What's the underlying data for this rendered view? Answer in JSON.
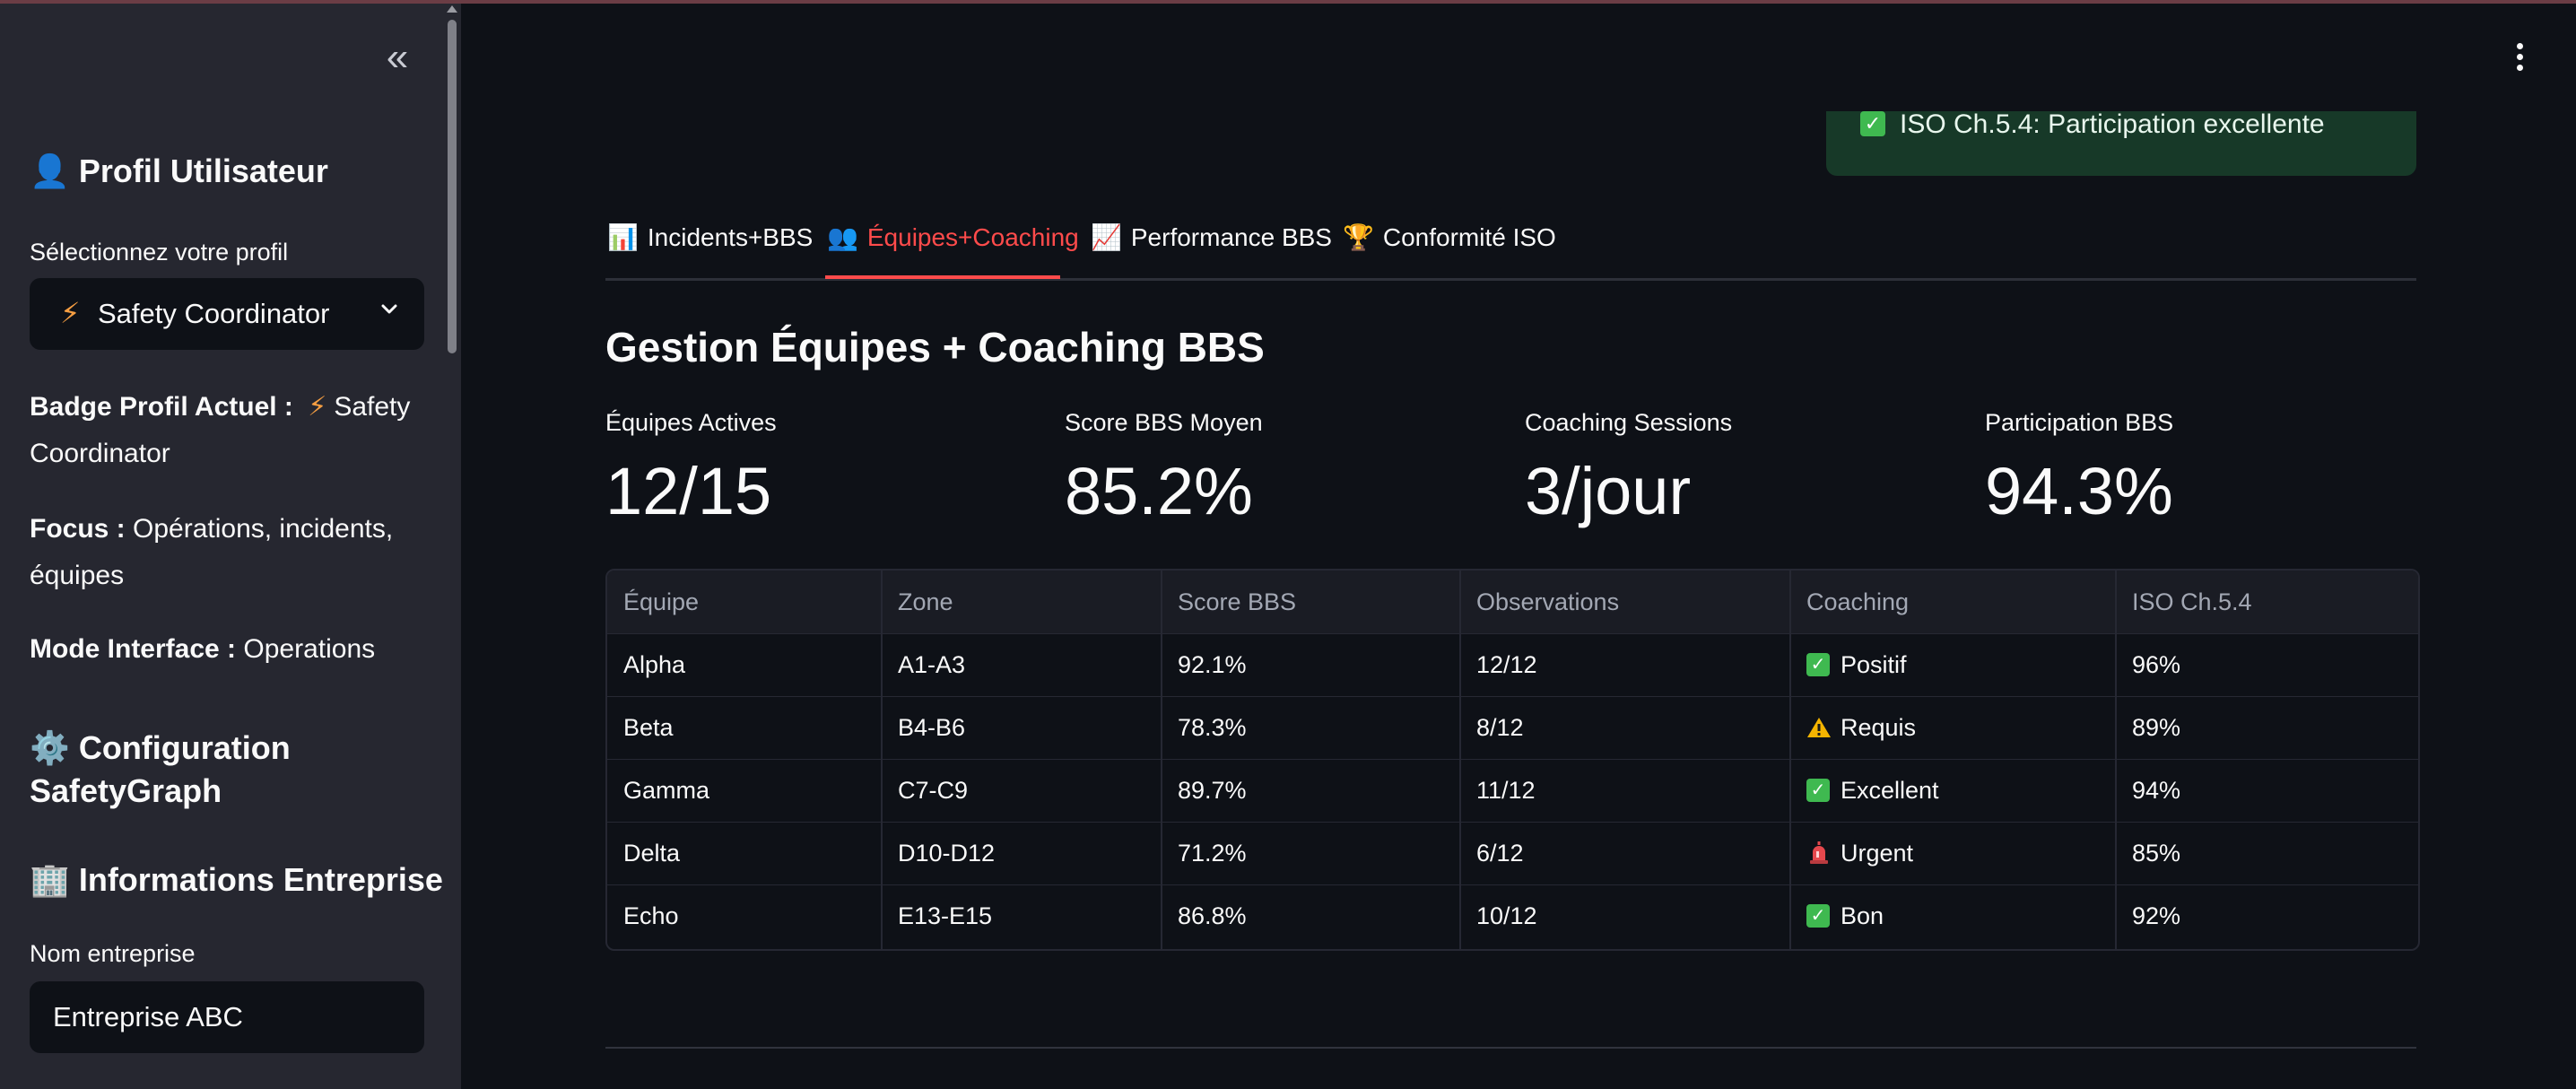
{
  "sidebar": {
    "collapse_icon": "«",
    "profile_heading": "Profil Utilisateur",
    "profile_icon": "👤",
    "select_label": "Sélectionnez votre profil",
    "select_value": "Safety Coordinator",
    "select_icon": "⚡",
    "badge_label": "Badge Profil Actuel :",
    "badge_icon": "⚡",
    "badge_value_line1": "Safety",
    "badge_value_line2": "Coordinator",
    "focus_label": "Focus :",
    "focus_value_line1": "Opérations, incidents,",
    "focus_value_line2": "équipes",
    "mode_label": "Mode Interface :",
    "mode_value": "Operations",
    "config_icon": "⚙️",
    "config_heading_line1": "Configuration",
    "config_heading_line2": "SafetyGraph",
    "company_icon": "🏢",
    "company_heading": "Informations Entreprise",
    "company_name_label": "Nom entreprise",
    "company_name_value": "Entreprise ABC"
  },
  "alert": {
    "icon": "✓",
    "text": "ISO Ch.5.4: Participation excellente",
    "color": "#173928"
  },
  "tabs": [
    {
      "icon": "📊",
      "label": "Incidents+BBS"
    },
    {
      "icon": "👥",
      "label": "Équipes+Coaching"
    },
    {
      "icon": "📈",
      "label": "Performance BBS"
    },
    {
      "icon": "🏆",
      "label": "Conformité ISO"
    }
  ],
  "active_tab": 1,
  "section_title": "Gestion Équipes + Coaching BBS",
  "metrics": [
    {
      "label": "Équipes Actives",
      "value": "12/15"
    },
    {
      "label": "Score BBS Moyen",
      "value": "85.2%"
    },
    {
      "label": "Coaching Sessions",
      "value": "3/jour"
    },
    {
      "label": "Participation BBS",
      "value": "94.3%"
    }
  ],
  "table": {
    "columns": [
      "Équipe",
      "Zone",
      "Score BBS",
      "Observations",
      "Coaching",
      "ISO Ch.5.4"
    ],
    "rows": [
      {
        "equipe": "Alpha",
        "zone": "A1-A3",
        "score": "92.1%",
        "obs": "12/12",
        "coach_icon": "check",
        "coach": "Positif",
        "iso": "96%"
      },
      {
        "equipe": "Beta",
        "zone": "B4-B6",
        "score": "78.3%",
        "obs": "8/12",
        "coach_icon": "warning",
        "coach": "Requis",
        "iso": "89%"
      },
      {
        "equipe": "Gamma",
        "zone": "C7-C9",
        "score": "89.7%",
        "obs": "11/12",
        "coach_icon": "check",
        "coach": "Excellent",
        "iso": "94%"
      },
      {
        "equipe": "Delta",
        "zone": "D10-D12",
        "score": "71.2%",
        "obs": "6/12",
        "coach_icon": "siren",
        "coach": "Urgent",
        "iso": "85%"
      },
      {
        "equipe": "Echo",
        "zone": "E13-E15",
        "score": "86.8%",
        "obs": "10/12",
        "coach_icon": "check",
        "coach": "Bon",
        "iso": "92%"
      }
    ]
  },
  "colors": {
    "accent": "#ff4b4b",
    "background": "#0e1117",
    "sidebar": "#262730"
  }
}
